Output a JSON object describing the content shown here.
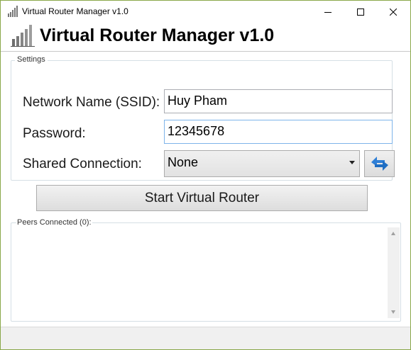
{
  "window": {
    "title": "Virtual Router Manager v1.0",
    "icon": "signal-bars-icon",
    "controls": [
      "minimize-icon",
      "maximize-icon",
      "close-icon"
    ]
  },
  "header": {
    "title": "Virtual Router Manager v1.0",
    "icon": "signal-bars-icon"
  },
  "settings": {
    "legend": "Settings",
    "ssid_label": "Network Name (SSID):",
    "ssid_value": "Huy Pham",
    "password_label": "Password:",
    "password_value": "12345678",
    "shared_label": "Shared Connection:",
    "shared_value": "None",
    "refresh_icon": "refresh-arrows-icon"
  },
  "actions": {
    "start_label": "Start Virtual Router"
  },
  "peers": {
    "legend": "Peers Connected (0):",
    "items": []
  },
  "colors": {
    "window_border": "#8aa84a",
    "focus_border": "#7eb4ea",
    "refresh_blue": "#2f7fd6"
  }
}
